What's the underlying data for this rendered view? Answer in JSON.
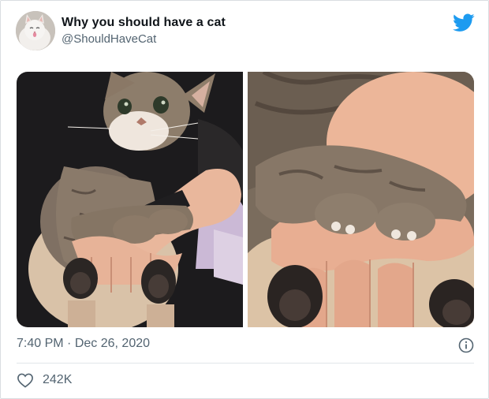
{
  "tweet": {
    "author_name": "Why you should have a cat",
    "author_handle": "@ShouldHaveCat",
    "time": "7:40 PM",
    "separator": "·",
    "date": "Dec 26, 2020",
    "like_count": "242K"
  },
  "icons": {
    "brand": "twitter-bird-icon",
    "info": "info-icon",
    "like": "heart-icon"
  },
  "colors": {
    "twitter_blue": "#1d9bf0",
    "secondary_text": "#536471",
    "primary_text": "#0f1419"
  }
}
